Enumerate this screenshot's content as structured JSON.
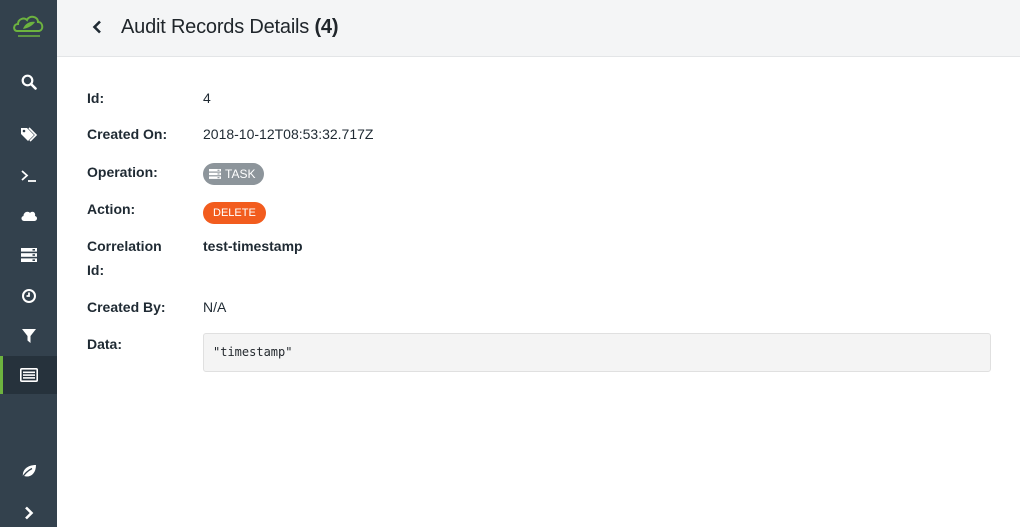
{
  "sidebar": {
    "logo_name": "spring-cloud-dataflow-logo",
    "items": [
      {
        "name": "search",
        "icon": "search-icon",
        "active": false
      },
      {
        "name": "apps",
        "icon": "tags-icon",
        "active": false
      },
      {
        "name": "shell",
        "icon": "terminal-icon",
        "active": false
      },
      {
        "name": "streams",
        "icon": "cloud-icon",
        "active": false
      },
      {
        "name": "tasks",
        "icon": "server-icon",
        "active": false
      },
      {
        "name": "jobs",
        "icon": "clock-icon",
        "active": false
      },
      {
        "name": "analytics",
        "icon": "filter-icon",
        "active": false
      },
      {
        "name": "audit-records",
        "icon": "list-icon",
        "active": true
      },
      {
        "name": "about",
        "icon": "leaf-icon",
        "active": false
      },
      {
        "name": "expand",
        "icon": "chevron-right-icon",
        "active": false
      }
    ]
  },
  "header": {
    "title": "Audit Records Details",
    "count": "(4)"
  },
  "details": {
    "id_label": "Id:",
    "id_value": "4",
    "created_on_label": "Created On:",
    "created_on_value": "2018-10-12T08:53:32.717Z",
    "operation_label": "Operation:",
    "operation_value": "TASK",
    "action_label": "Action:",
    "action_value": "DELETE",
    "correlation_label_1": "Correlation",
    "correlation_label_2": "Id:",
    "correlation_value": "test-timestamp",
    "created_by_label": "Created By:",
    "created_by_value": "N/A",
    "data_label": "Data:",
    "data_value": "\"timestamp\""
  },
  "colors": {
    "sidebar_bg": "#33414d",
    "accent": "#6db33f",
    "task_badge": "#8d959b",
    "delete_badge": "#f25c1e"
  }
}
